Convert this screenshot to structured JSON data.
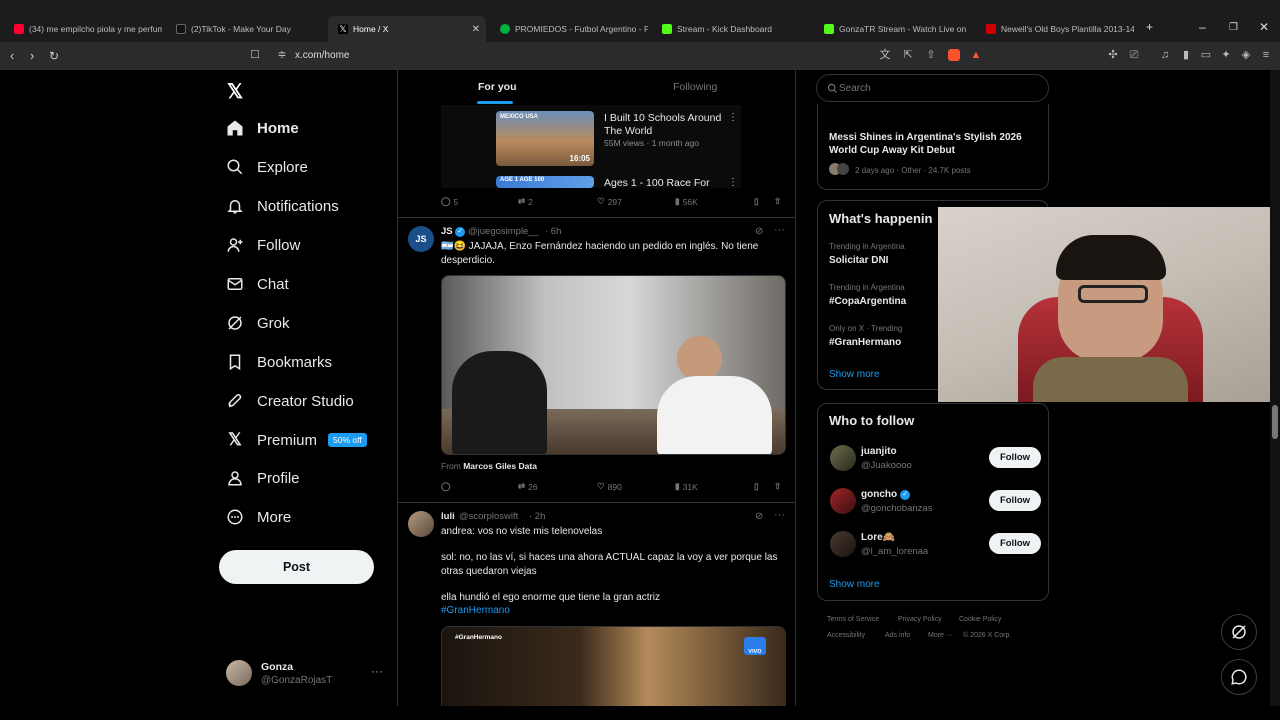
{
  "browser": {
    "tabs": [
      {
        "title": "(34) me empilcho piola y me perfum",
        "color": "#ff0033"
      },
      {
        "title": "(2)TikTok - Make Your Day",
        "color": "#ffffff"
      },
      {
        "title": "Home / X",
        "color": "#ffffff"
      },
      {
        "title": "PROMIEDOS - Futbol Argentino - Fu",
        "color": "#00b140"
      },
      {
        "title": "Stream - Kick Dashboard",
        "color": "#53fc18"
      },
      {
        "title": "GonzaTR Stream - Watch Live on",
        "color": "#53fc18"
      },
      {
        "title": "Newell's Old Boys Plantilla 2013-14",
        "color": "#d00000"
      }
    ],
    "url": "x.com/home"
  },
  "nav": {
    "items": [
      {
        "label": "Home",
        "icon": "home-icon"
      },
      {
        "label": "Explore",
        "icon": "search-icon"
      },
      {
        "label": "Notifications",
        "icon": "bell-icon"
      },
      {
        "label": "Follow",
        "icon": "follow-icon"
      },
      {
        "label": "Chat",
        "icon": "mail-icon"
      },
      {
        "label": "Grok",
        "icon": "grok-icon"
      },
      {
        "label": "Bookmarks",
        "icon": "bookmark-icon"
      },
      {
        "label": "Creator Studio",
        "icon": "rocket-icon"
      },
      {
        "label": "Premium",
        "icon": "x-logo-icon"
      },
      {
        "label": "Profile",
        "icon": "person-icon"
      },
      {
        "label": "More",
        "icon": "more-circle-icon"
      }
    ],
    "premium_badge": "50% off",
    "post_label": "Post",
    "account": {
      "name": "Gonza",
      "handle": "@GonzaRojasT"
    }
  },
  "feed": {
    "tabs": {
      "for_you": "For you",
      "following": "Following"
    },
    "video_card": [
      {
        "title": "I Built 10 Schools Around The World",
        "meta": "55M views · 1 month ago",
        "duration": "16:05",
        "flags": "MEXICO  USA"
      },
      {
        "title": "Ages 1 - 100 Race For",
        "flags": "AGE 1   AGE 100"
      }
    ],
    "tweet1_actions": {
      "replies": "5",
      "reposts": "2",
      "likes": "297",
      "views": "56K"
    },
    "tweet2": {
      "name": "JS",
      "handle": "@juegosimple__",
      "time": "· 6h",
      "text": "🇦🇷😆 JAJAJA, Enzo Fernández haciendo un pedido en inglés. No tiene desperdicio.",
      "from_label": "From",
      "from_source": "Marcos Giles Data",
      "actions": {
        "replies": "",
        "reposts": "26",
        "likes": "890",
        "views": "31K"
      }
    },
    "tweet3": {
      "name": "luli",
      "handle": "@scorploswift",
      "time": "· 2h",
      "line1": "andrea: vos no viste mis telenovelas",
      "line2": "sol: no, no las ví, si haces una ahora ACTUAL capaz la voy a ver porque las otras quedaron viejas",
      "line3": "ella hundió el ego enorme que tiene la gran actriz",
      "hashtag": "#GranHermano",
      "media_tag": "#GranHermano",
      "media_logo": "VIVO"
    }
  },
  "right": {
    "search_placeholder": "Search",
    "news": {
      "title": "Messi Shines in Argentina's Stylish 2026 World Cup Away Kit Debut",
      "meta": "2 days ago · Other · 24.7K posts"
    },
    "happening_title": "What's happenin",
    "trends": [
      {
        "meta": "Trending in Argentina",
        "name": "Solicitar DNI"
      },
      {
        "meta": "Trending in Argentina",
        "name": "#CopaArgentina"
      },
      {
        "meta": "Only on X · Trending",
        "name": "#GranHermano"
      }
    ],
    "show_more": "Show more",
    "wtf_title": "Who to follow",
    "follow_label": "Follow",
    "who_to_follow": [
      {
        "name": "juanjito",
        "handle": "@Juakoooo"
      },
      {
        "name": "goncho",
        "handle": "@gonchobanzas"
      },
      {
        "name": "Lore🙈",
        "handle": "@l_am_lorenaa"
      }
    ],
    "footer": {
      "tos": "Terms of Service",
      "privacy": "Privacy Policy",
      "cookie": "Cookie Policy",
      "access": "Accessibility",
      "ads": "Ads info",
      "more": "More ···",
      "copy": "© 2026 X Corp."
    }
  },
  "colors": {
    "accent": "#1d9bf0",
    "bg": "#000000",
    "border": "#2f3336"
  }
}
